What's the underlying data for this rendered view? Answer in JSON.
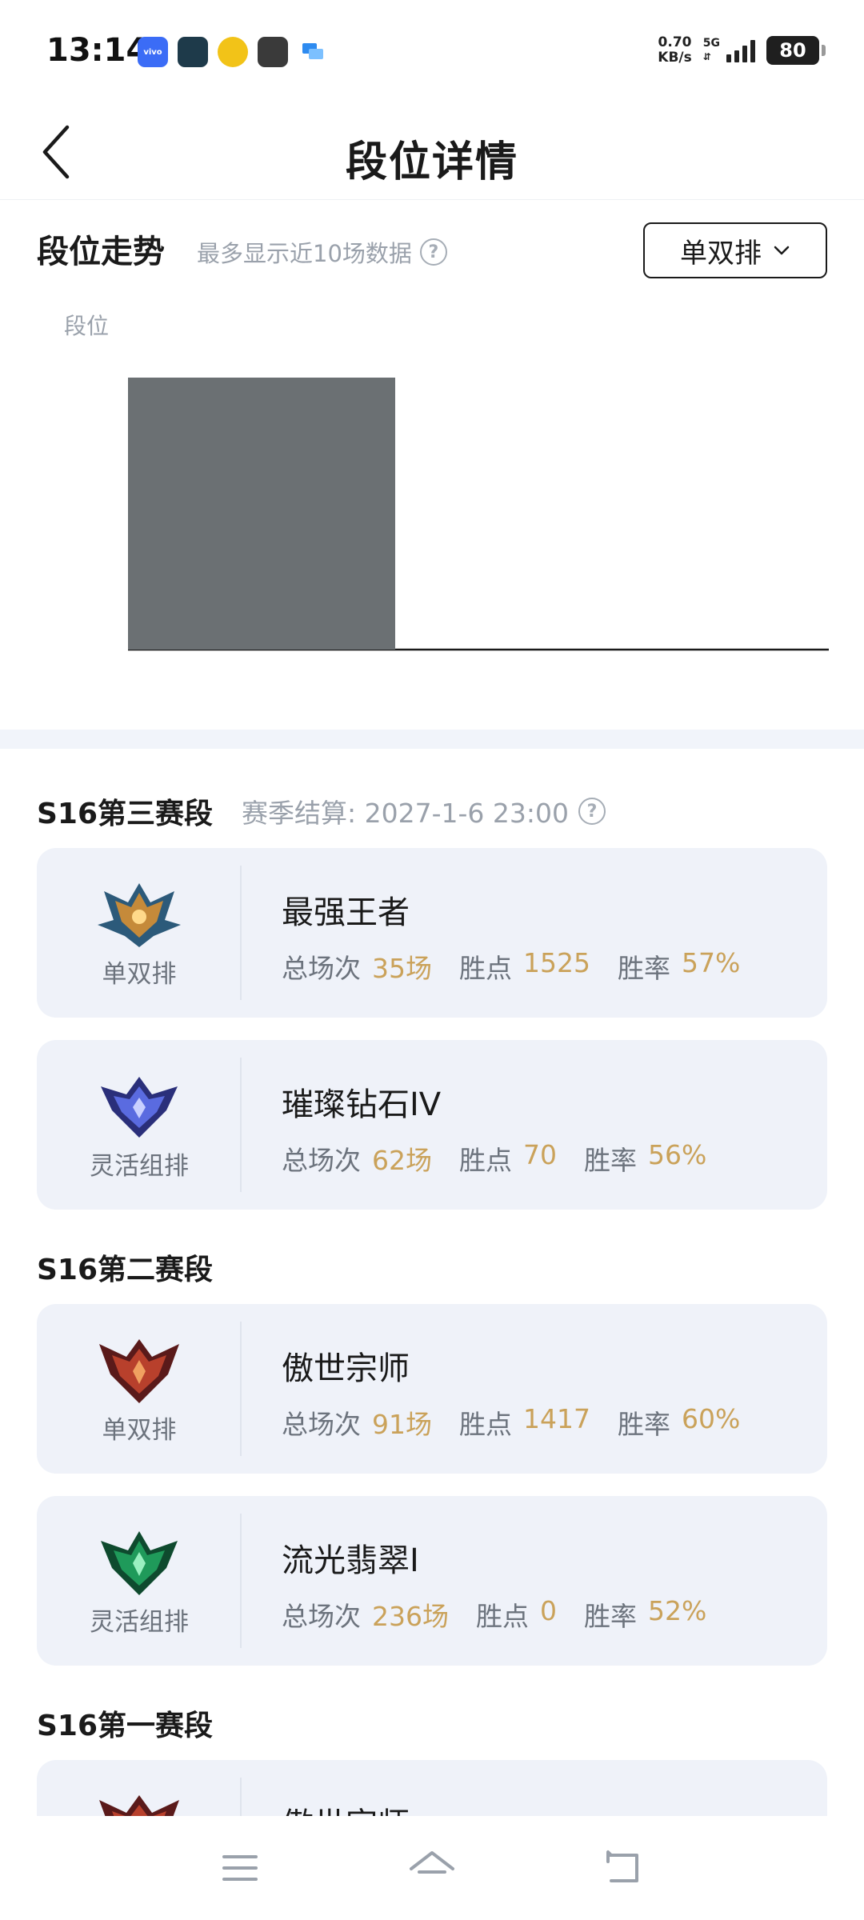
{
  "status_bar": {
    "time": "13:14",
    "apps": [
      {
        "name": "vivo",
        "color": "#3b6cf6"
      },
      {
        "name": "game",
        "color": "#1e3a4a"
      },
      {
        "name": "coin",
        "color": "#f2c318"
      },
      {
        "name": "avatar",
        "color": "#3a3a3a"
      },
      {
        "name": "chat",
        "color": "#2e8bf0"
      }
    ],
    "speed_value": "0.70",
    "speed_unit": "KB/s",
    "network": "5G",
    "battery": "80"
  },
  "header": {
    "title": "段位详情",
    "back_icon": "chevron-left-icon"
  },
  "trend": {
    "title": "段位走势",
    "hint": "最多显示近10场数据",
    "help_icon": "question-circle-icon",
    "mode_label": "单双排",
    "mode_icon": "chevron-down-icon",
    "y_label": "段位"
  },
  "chart_data": {
    "type": "bar",
    "categories": [
      ""
    ],
    "values": [
      1
    ],
    "bar_color": "#6b7073",
    "ylabel": "段位",
    "title": "",
    "grid": false
  },
  "seasons": [
    {
      "title": "S16第三赛段",
      "settle_label": "赛季结算: 2027-1-6 23:00",
      "cards": [
        {
          "queue": "单双排",
          "rank": "最强王者",
          "emblem": "king-emblem-icon",
          "emblem_color": "#c58a3a",
          "stats": [
            {
              "label": "总场次",
              "value": "35场"
            },
            {
              "label": "胜点",
              "value": "1525"
            },
            {
              "label": "胜率",
              "value": "57%"
            }
          ]
        },
        {
          "queue": "灵活组排",
          "rank": "璀璨钻石IV",
          "emblem": "diamond-emblem-icon",
          "emblem_color": "#4a56c8",
          "stats": [
            {
              "label": "总场次",
              "value": "62场"
            },
            {
              "label": "胜点",
              "value": "70"
            },
            {
              "label": "胜率",
              "value": "56%"
            }
          ]
        }
      ]
    },
    {
      "title": "S16第二赛段",
      "cards": [
        {
          "queue": "单双排",
          "rank": "傲世宗师",
          "emblem": "grandmaster-emblem-icon",
          "emblem_color": "#b8402c",
          "stats": [
            {
              "label": "总场次",
              "value": "91场"
            },
            {
              "label": "胜点",
              "value": "1417"
            },
            {
              "label": "胜率",
              "value": "60%"
            }
          ]
        },
        {
          "queue": "灵活组排",
          "rank": "流光翡翠I",
          "emblem": "emerald-emblem-icon",
          "emblem_color": "#1f9a5a",
          "stats": [
            {
              "label": "总场次",
              "value": "236场"
            },
            {
              "label": "胜点",
              "value": "0"
            },
            {
              "label": "胜率",
              "value": "52%"
            }
          ]
        }
      ]
    },
    {
      "title": "S16第一赛段",
      "cards": [
        {
          "queue": "",
          "rank": "傲世宗师",
          "emblem": "grandmaster-emblem-icon",
          "emblem_color": "#b8402c",
          "stats": []
        }
      ]
    }
  ],
  "navbar": {
    "menu_icon": "menu-icon",
    "home_icon": "home-icon",
    "back_icon": "back-arrow-icon"
  }
}
